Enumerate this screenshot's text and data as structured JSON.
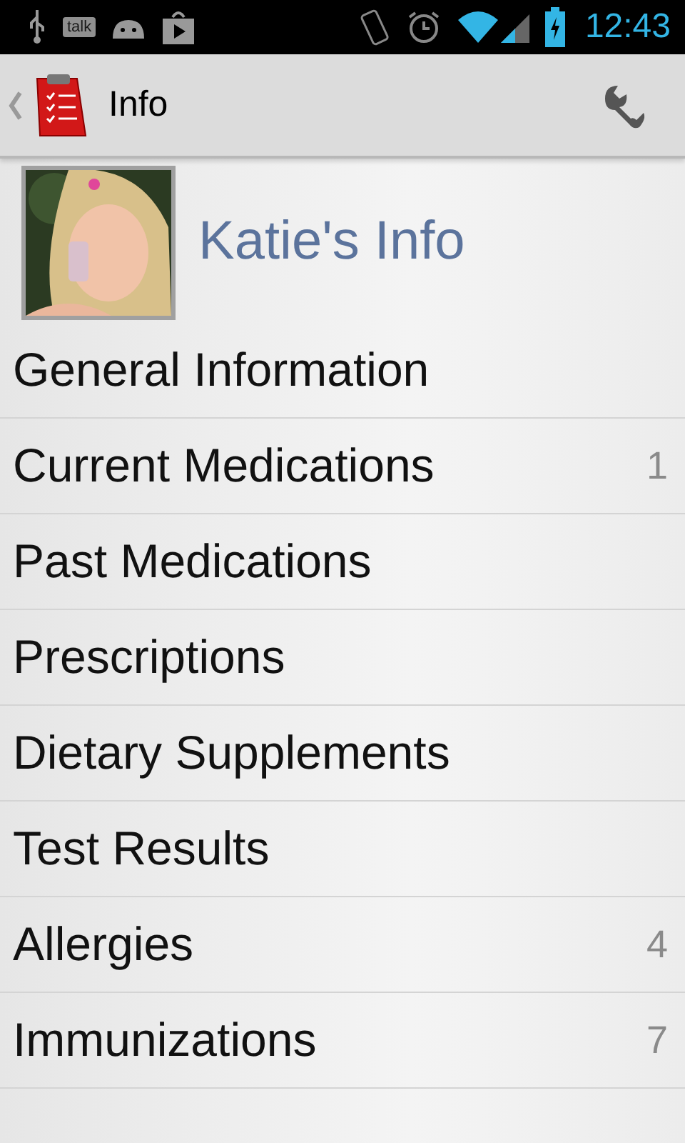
{
  "status_bar": {
    "talk_label": "talk",
    "time": "12:43"
  },
  "action_bar": {
    "title": "Info"
  },
  "header": {
    "title": "Katie's Info"
  },
  "items": [
    {
      "label": "General Information"
    },
    {
      "label": "Current Medications",
      "count": "1"
    },
    {
      "label": "Past Medications"
    },
    {
      "label": "Prescriptions"
    },
    {
      "label": "Dietary Supplements"
    },
    {
      "label": "Test Results"
    },
    {
      "label": "Allergies",
      "count": "4"
    },
    {
      "label": "Immunizations",
      "count": "7"
    }
  ]
}
